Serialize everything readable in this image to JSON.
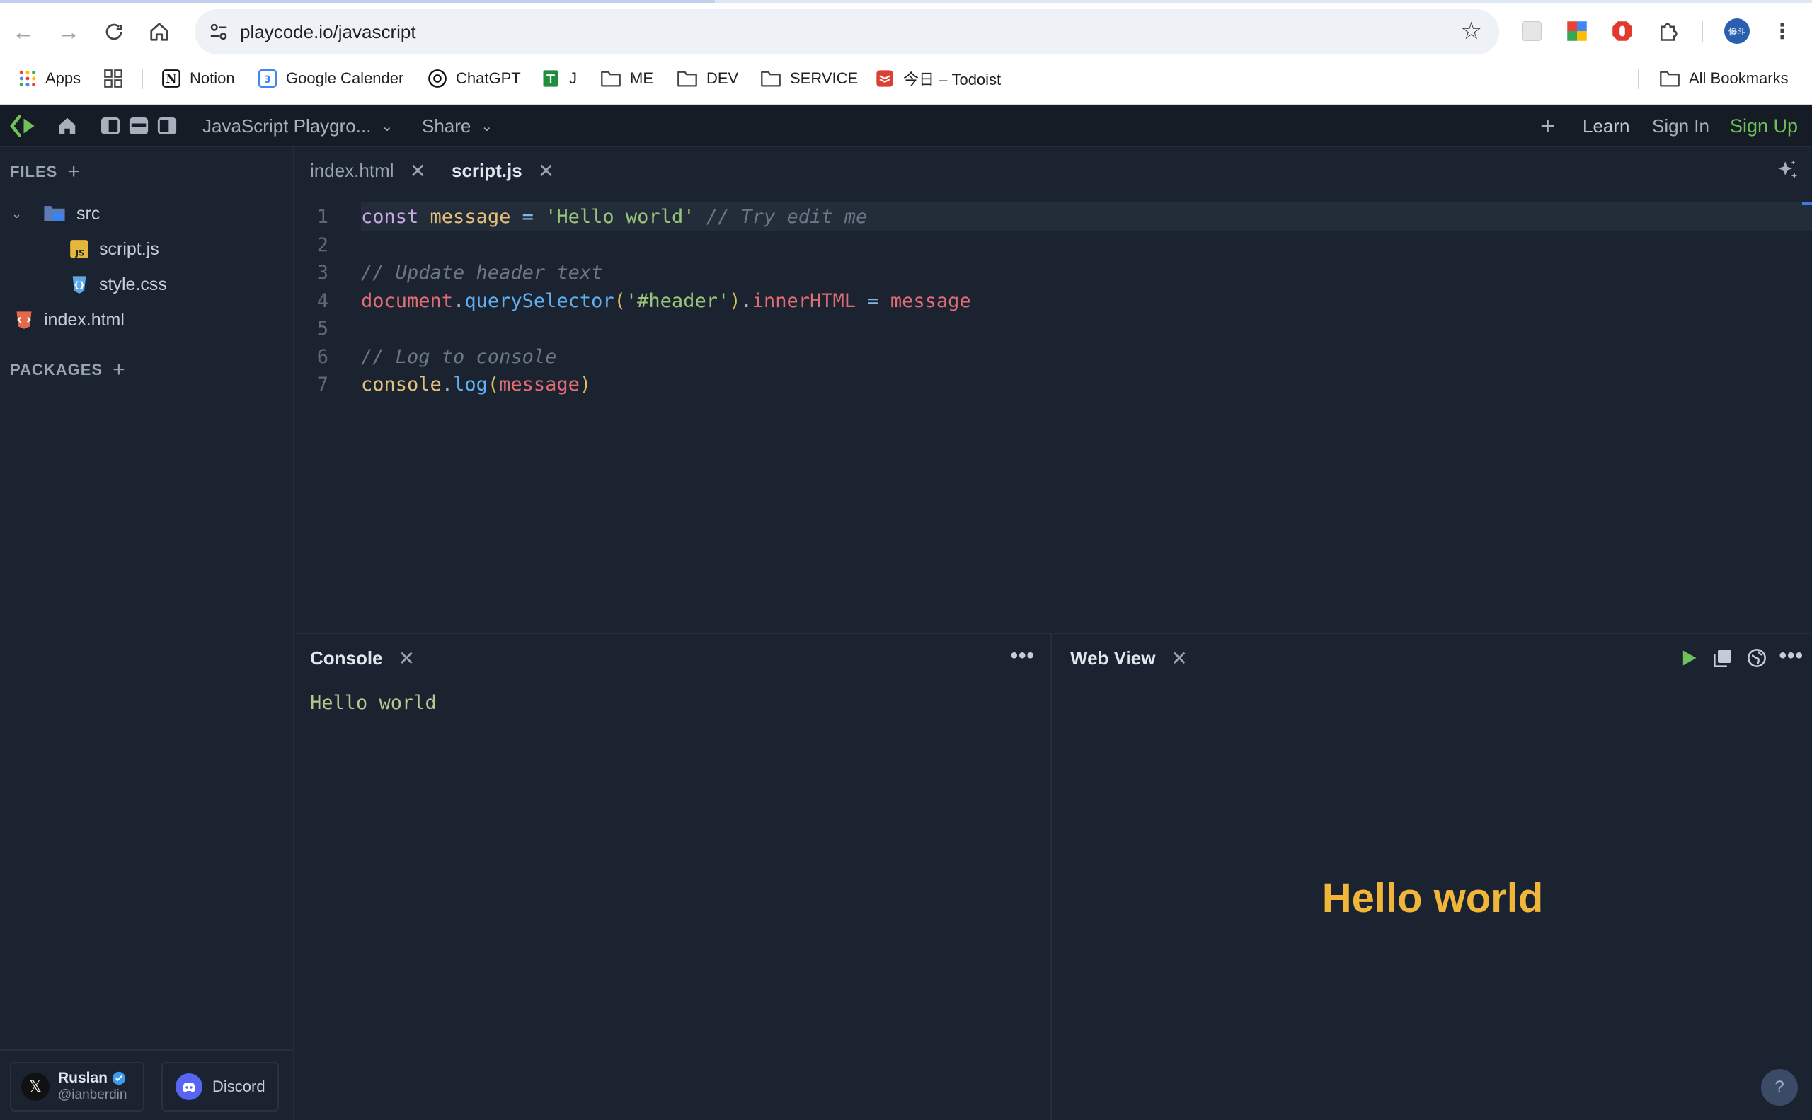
{
  "browser": {
    "url": "playcode.io/javascript",
    "bookmarks": {
      "apps": "Apps",
      "notion": "Notion",
      "google_calendar": "Google Calender",
      "chatgpt": "ChatGPT",
      "j": "J",
      "me": "ME",
      "dev": "DEV",
      "service": "SERVICE",
      "todoist": "今日 – Todoist",
      "all_bookmarks": "All Bookmarks"
    }
  },
  "header": {
    "project_title": "JavaScript Playgro...",
    "share": "Share",
    "learn": "Learn",
    "sign_in": "Sign In",
    "sign_up": "Sign Up"
  },
  "sidebar": {
    "files_title": "FILES",
    "packages_title": "PACKAGES",
    "tree": {
      "src": "src",
      "script": "script.js",
      "style": "style.css",
      "index": "index.html"
    },
    "footer": {
      "author_name": "Ruslan",
      "author_handle": "@ianberdin",
      "discord": "Discord"
    }
  },
  "editor": {
    "tabs": [
      "index.html",
      "script.js"
    ],
    "active_tab": "script.js",
    "line_numbers": [
      "1",
      "2",
      "3",
      "4",
      "5",
      "6",
      "7"
    ]
  },
  "console": {
    "title": "Console",
    "output": "Hello world"
  },
  "webview": {
    "title": "Web View",
    "heading": "Hello world"
  },
  "colors": {
    "accent_green": "#6fbf5a",
    "heading_yellow": "#f0b63a",
    "background": "#1b2330"
  }
}
